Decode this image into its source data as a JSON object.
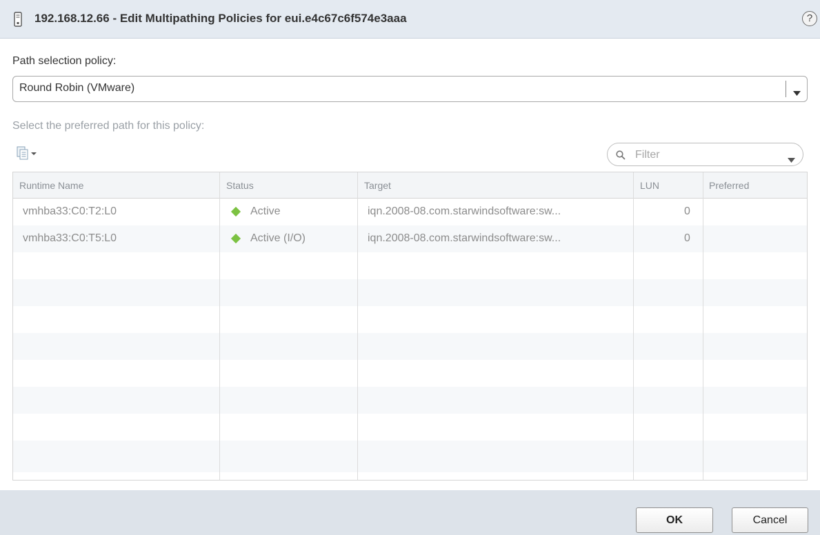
{
  "dialog": {
    "title": "192.168.12.66 - Edit Multipathing Policies for eui.e4c67c6f574e3aaa",
    "icons": {
      "title_icon": "storage-device-icon",
      "help": "help-icon"
    },
    "help_label": "?"
  },
  "policy": {
    "label": "Path selection policy:",
    "selected": "Round Robin (VMware)"
  },
  "preferred": {
    "label": "Select the preferred path for this policy:"
  },
  "toolbar": {
    "copy_icon": "copy-icon",
    "filter_placeholder": "Filter"
  },
  "table": {
    "columns": [
      "Runtime Name",
      "Status",
      "Target",
      "LUN",
      "Preferred"
    ],
    "rows": [
      {
        "runtime_name": "vmhba33:C0:T2:L0",
        "status": "Active",
        "target": "iqn.2008-08.com.starwindsoftware:sw...",
        "lun": "0",
        "preferred": ""
      },
      {
        "runtime_name": "vmhba33:C0:T5:L0",
        "status": "Active (I/O)",
        "target": "iqn.2008-08.com.starwindsoftware:sw...",
        "lun": "0",
        "preferred": ""
      }
    ]
  },
  "footer": {
    "ok_label": "OK",
    "cancel_label": "Cancel"
  },
  "colors": {
    "status_active": "#7cc242",
    "header_bg": "#e4eaf1",
    "footer_bg": "#dde3ea"
  }
}
